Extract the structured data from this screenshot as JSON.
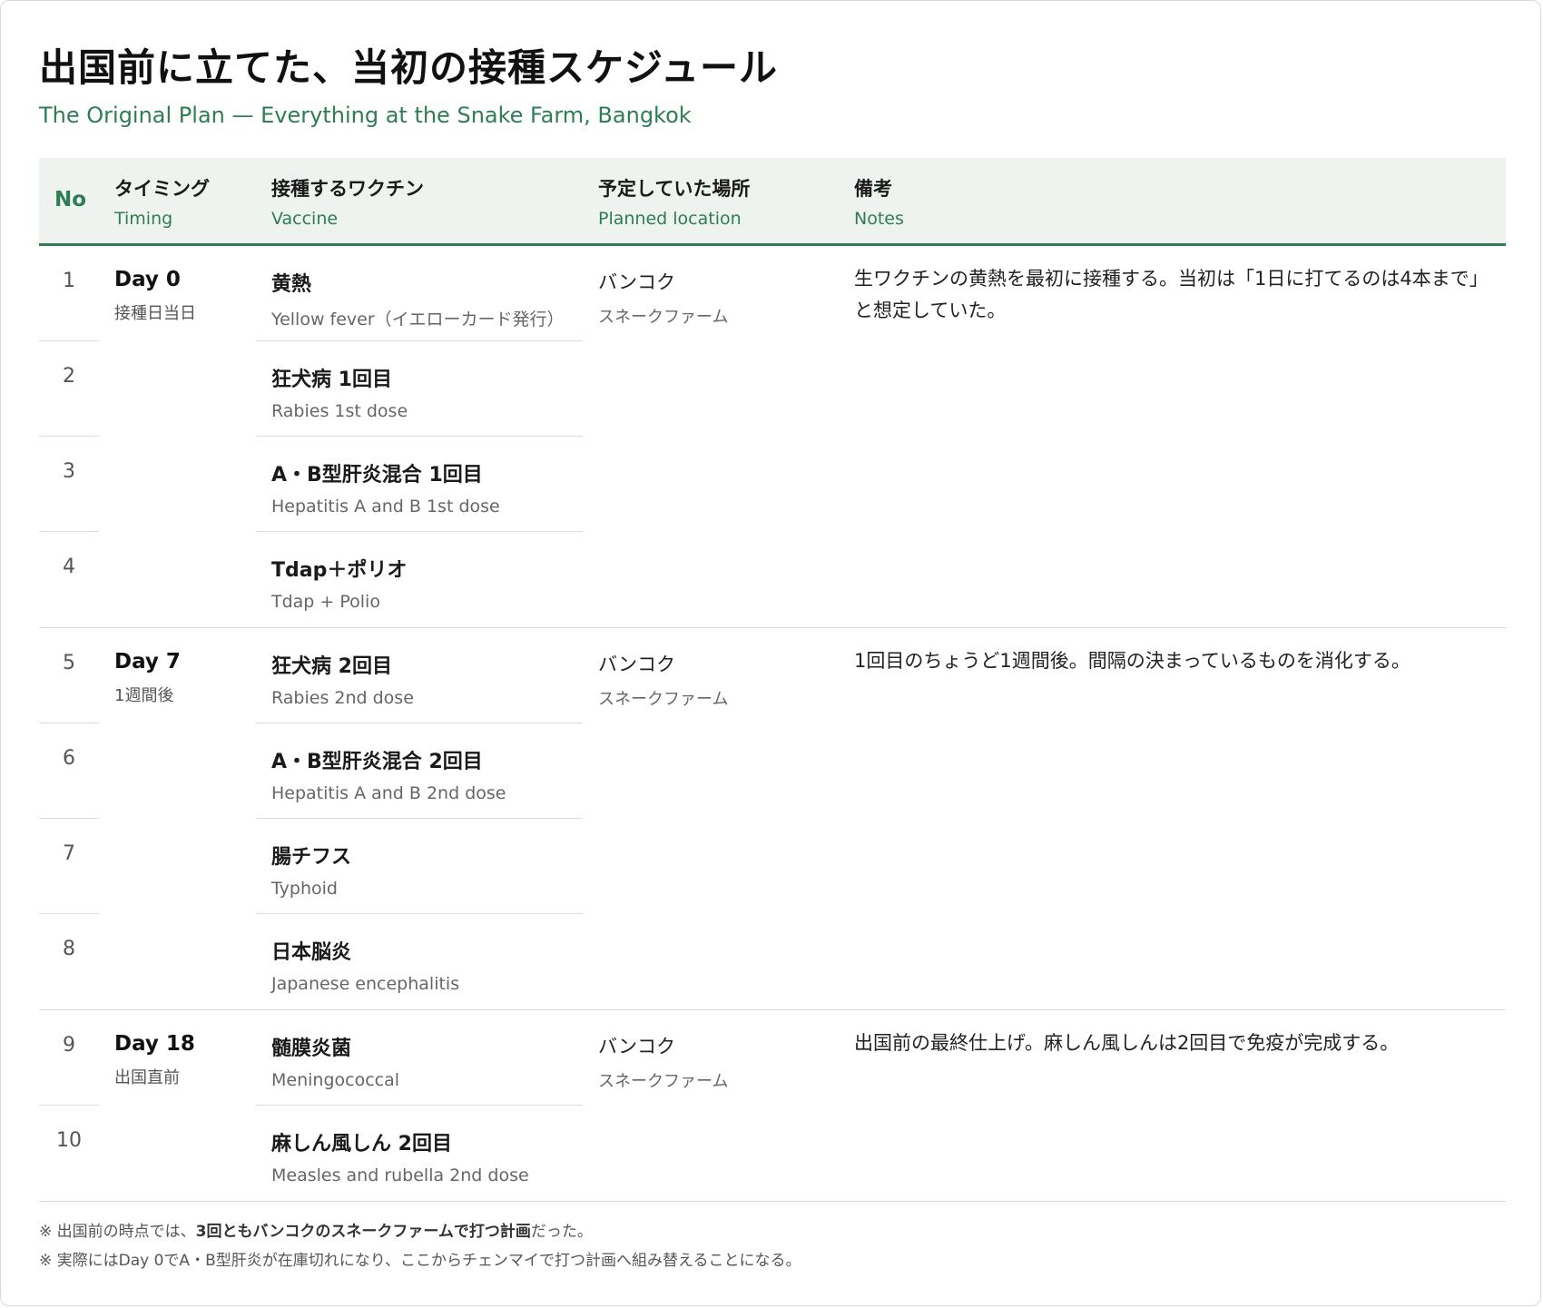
{
  "title": "出国前に立てた、当初の接種スケジュール",
  "subtitle": "The Original Plan — Everything at the Snake Farm, Bangkok",
  "header": {
    "no": "No",
    "timing_ja": "タイミング",
    "timing_en": "Timing",
    "vaccine_ja": "接種するワクチン",
    "vaccine_en": "Vaccine",
    "place_ja": "予定していた場所",
    "place_en": "Planned location",
    "notes_ja": "備考",
    "notes_en": "Notes"
  },
  "groups": [
    {
      "day": "Day 0",
      "day_sub": "接種日当日",
      "place_1": "バンコク",
      "place_2": "スネークファーム",
      "notes": "生ワクチンの黄熱を最初に接種する。当初は「1日に打てるのは4本まで」と想定していた。",
      "rows": [
        {
          "no": "1",
          "ja": "黄熱",
          "en": "Yellow fever（イエローカード発行）"
        },
        {
          "no": "2",
          "ja": "狂犬病 1回目",
          "en": "Rabies 1st dose"
        },
        {
          "no": "3",
          "ja": "A・B型肝炎混合 1回目",
          "en": "Hepatitis A and B 1st dose"
        },
        {
          "no": "4",
          "ja": "Tdap＋ポリオ",
          "en": "Tdap + Polio"
        }
      ]
    },
    {
      "day": "Day 7",
      "day_sub": "1週間後",
      "place_1": "バンコク",
      "place_2": "スネークファーム",
      "notes": "1回目のちょうど1週間後。間隔の決まっているものを消化する。",
      "rows": [
        {
          "no": "5",
          "ja": "狂犬病 2回目",
          "en": "Rabies 2nd dose"
        },
        {
          "no": "6",
          "ja": "A・B型肝炎混合 2回目",
          "en": "Hepatitis A and B 2nd dose"
        },
        {
          "no": "7",
          "ja": "腸チフス",
          "en": "Typhoid"
        },
        {
          "no": "8",
          "ja": "日本脳炎",
          "en": "Japanese encephalitis"
        }
      ]
    },
    {
      "day": "Day 18",
      "day_sub": "出国直前",
      "place_1": "バンコク",
      "place_2": "スネークファーム",
      "notes": "出国前の最終仕上げ。麻しん風しんは2回目で免疫が完成する。",
      "rows": [
        {
          "no": "9",
          "ja": "髄膜炎菌",
          "en": "Meningococcal"
        },
        {
          "no": "10",
          "ja": "麻しん風しん 2回目",
          "en": "Measles and rubella 2nd dose"
        }
      ]
    }
  ],
  "footnotes": {
    "line1_pre": "※ 出国前の時点では、",
    "line1_bold": "3回ともバンコクのスネークファームで打つ計画",
    "line1_post": "だった。",
    "line2": "※ 実際にはDay 0でA・B型肝炎が在庫切れになり、ここからチェンマイで打つ計画へ組み替えることになる。"
  }
}
